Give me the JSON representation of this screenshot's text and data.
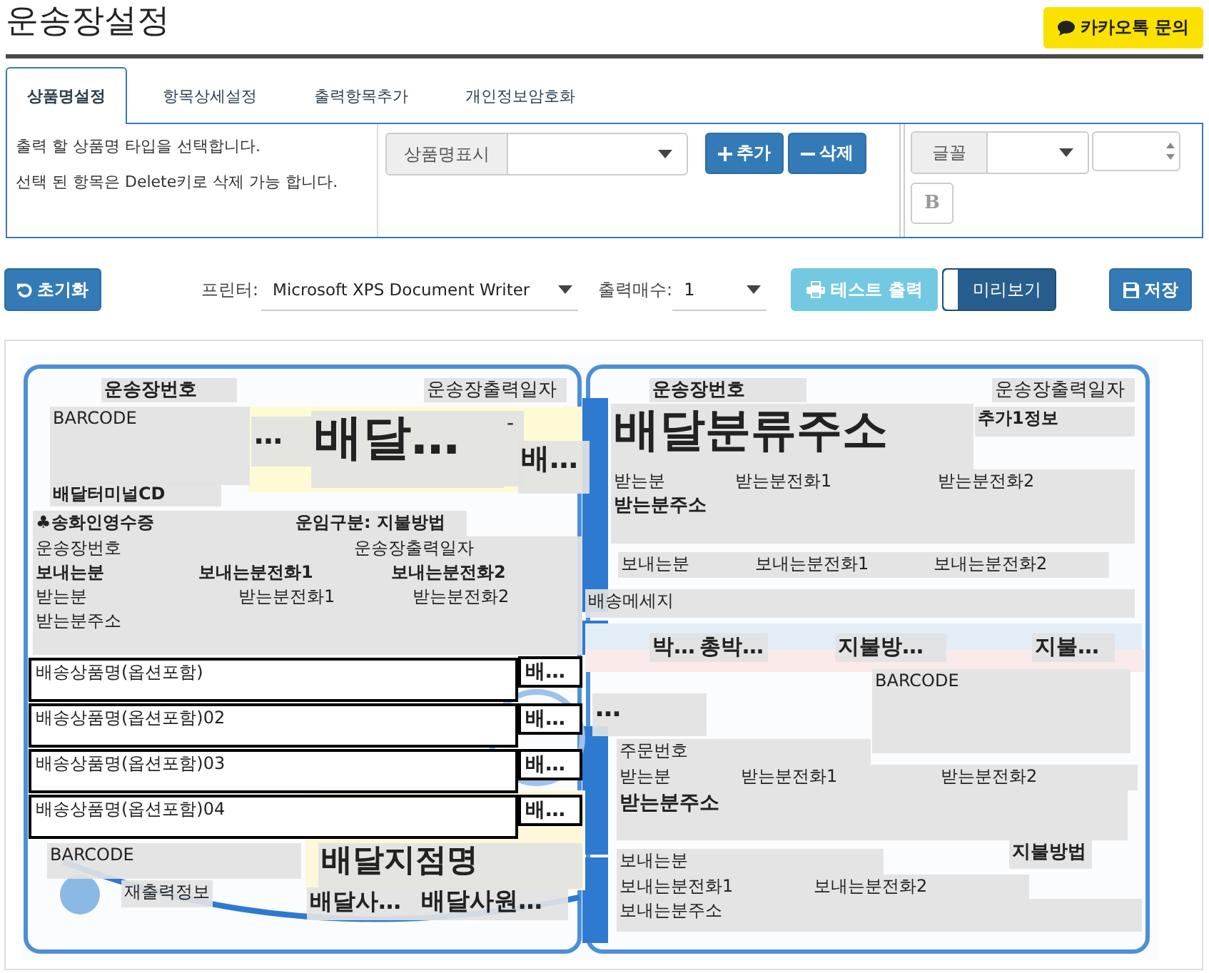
{
  "title": "운송장설정",
  "kakao_button": {
    "label": "카카오톡 문의"
  },
  "tabs": [
    {
      "label": "상품명설정",
      "selected": true
    },
    {
      "label": "항목상세설정",
      "selected": false
    },
    {
      "label": "출력항목추가",
      "selected": false
    },
    {
      "label": "개인정보암호화",
      "selected": false
    }
  ],
  "panel": {
    "instructions": [
      "출력 할 상품명 타입을 선택합니다.",
      "선택 된 항목은 Delete키로 삭제 가능 합니다."
    ],
    "product_name_select": {
      "label": "상품명표시"
    },
    "buttons": [
      {
        "label": "추가",
        "kind": "add"
      },
      {
        "label": "삭제",
        "kind": "remove"
      }
    ],
    "font_select": {
      "label": "글꼴"
    },
    "bold_button": {
      "label": "B"
    }
  },
  "toolbar": {
    "reset_button": {
      "label": "초기화"
    },
    "printer": {
      "label": "프린터:",
      "value": "Microsoft XPS Document Writer"
    },
    "copies": {
      "label": "출력매수:",
      "value": "1"
    },
    "test_print_button": {
      "label": "테스트 출력"
    },
    "preview_toggle": {
      "label": "미리보기",
      "on": true
    },
    "save_button": {
      "label": "저장"
    }
  },
  "label_fields": [
    {
      "text": "운송장번호",
      "kind": "field"
    },
    {
      "text": "운송장출력일자",
      "kind": "field"
    },
    {
      "text": "BARCODE",
      "kind": "field"
    },
    {
      "text": "…",
      "kind": "field"
    },
    {
      "text": "배달…",
      "kind": "field"
    },
    {
      "text": "-",
      "kind": "field"
    },
    {
      "text": "배…",
      "kind": "field"
    },
    {
      "text": "배달터미널CD",
      "kind": "field"
    },
    {
      "text": "♣송화인영수증",
      "kind": "field"
    },
    {
      "text": "운임구분:  지불방법",
      "kind": "field"
    },
    {
      "text": "운송장번호",
      "kind": "field"
    },
    {
      "text": "운송장출력일자",
      "kind": "field"
    },
    {
      "text": "보내는분",
      "kind": "field"
    },
    {
      "text": "보내는분전화1",
      "kind": "field"
    },
    {
      "text": "보내는분전화2",
      "kind": "field"
    },
    {
      "text": "받는분",
      "kind": "field"
    },
    {
      "text": "받는분전화1",
      "kind": "field"
    },
    {
      "text": "받는분전화2",
      "kind": "field"
    },
    {
      "text": "받는분주소",
      "kind": "field"
    },
    {
      "text": "배송상품명(옵션포함)",
      "kind": "outlined"
    },
    {
      "text": "배…",
      "kind": "outlined"
    },
    {
      "text": "배송상품명(옵션포함)02",
      "kind": "outlined"
    },
    {
      "text": "배…",
      "kind": "outlined"
    },
    {
      "text": "배송상품명(옵션포함)03",
      "kind": "outlined"
    },
    {
      "text": "배…",
      "kind": "outlined"
    },
    {
      "text": "배송상품명(옵션포함)04",
      "kind": "outlined"
    },
    {
      "text": "배…",
      "kind": "outlined"
    },
    {
      "text": "BARCODE",
      "kind": "field"
    },
    {
      "text": "재출력정보",
      "kind": "field"
    },
    {
      "text": "배달지점명",
      "kind": "field"
    },
    {
      "text": "배달사…",
      "kind": "field"
    },
    {
      "text": "배달사원…",
      "kind": "field"
    },
    {
      "text": "운송장번호",
      "kind": "field"
    },
    {
      "text": "운송장출력일자",
      "kind": "field"
    },
    {
      "text": "배달분류주소",
      "kind": "field"
    },
    {
      "text": "추가1정보",
      "kind": "field"
    },
    {
      "text": "받는분",
      "kind": "field"
    },
    {
      "text": "받는분전화1",
      "kind": "field"
    },
    {
      "text": "받는분전화2",
      "kind": "field"
    },
    {
      "text": "받는분주소",
      "kind": "field"
    },
    {
      "text": "보내는분",
      "kind": "field"
    },
    {
      "text": "보내는분전화1",
      "kind": "field"
    },
    {
      "text": "보내는분전화2",
      "kind": "field"
    },
    {
      "text": "배송메세지",
      "kind": "field"
    },
    {
      "text": "박…",
      "kind": "field"
    },
    {
      "text": "총박…",
      "kind": "field"
    },
    {
      "text": "지불방…",
      "kind": "field"
    },
    {
      "text": "지불…",
      "kind": "field"
    },
    {
      "text": "…",
      "kind": "field"
    },
    {
      "text": "BARCODE",
      "kind": "field"
    },
    {
      "text": "주문번호",
      "kind": "field"
    },
    {
      "text": "받는분",
      "kind": "field"
    },
    {
      "text": "받는분전화1",
      "kind": "field"
    },
    {
      "text": "받는분전화2",
      "kind": "field"
    },
    {
      "text": "받는분주소",
      "kind": "field"
    },
    {
      "text": "지불방법",
      "kind": "field"
    },
    {
      "text": "보내는분",
      "kind": "field"
    },
    {
      "text": "보내는분전화1",
      "kind": "field"
    },
    {
      "text": "보내는분전화2",
      "kind": "field"
    },
    {
      "text": "보내는분주소",
      "kind": "field"
    }
  ]
}
